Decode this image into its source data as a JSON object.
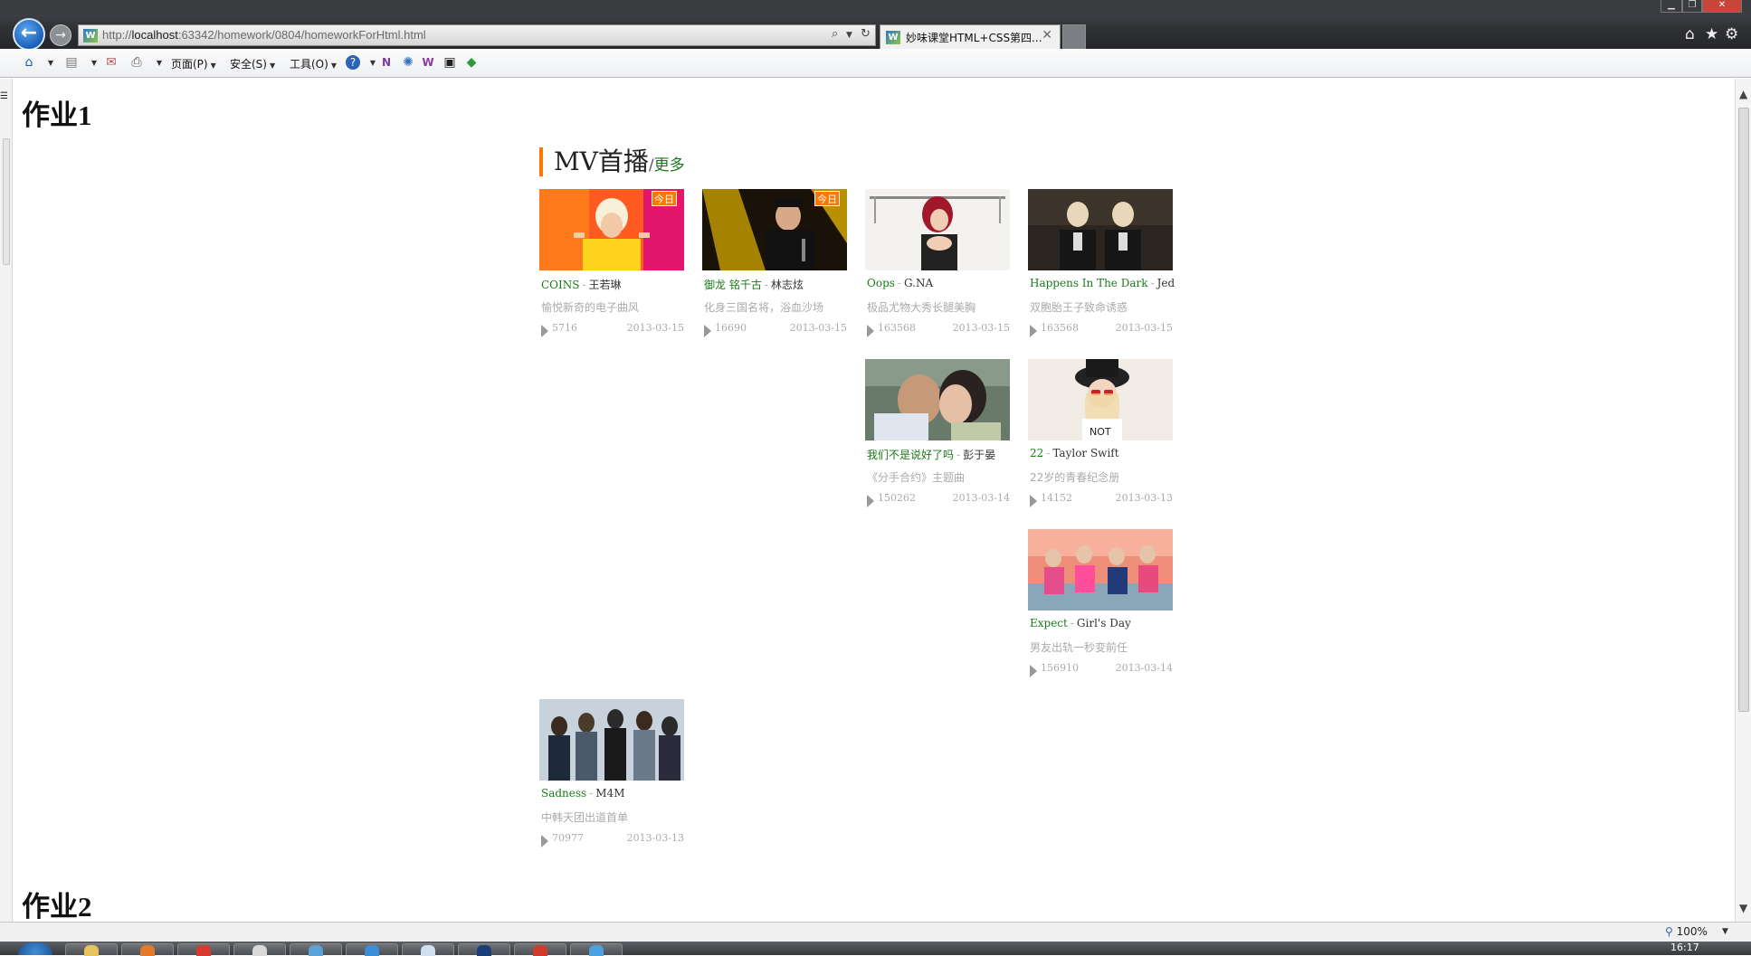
{
  "browser": {
    "url_prefix": "http://",
    "url_host": "localhost",
    "url_rest": ":63342/homework/0804/homeworkForHtml.html",
    "tab_title": "妙味课堂HTML+CSS第四...",
    "tab_close": "✕",
    "menus": {
      "page": "页面(P)",
      "safety": "安全(S)",
      "tools": "工具(O)"
    },
    "zoom": "100%",
    "clock": "16:17"
  },
  "page": {
    "hw1_title": "作业1",
    "hw2_title": "作业2",
    "mv": {
      "title": "MV首播",
      "separator": "/",
      "more": "更多",
      "badge": "今日",
      "items": [
        {
          "song": "COINS",
          "artist": "王若琳",
          "desc": "愉悦新奇的电子曲风",
          "count": "5716",
          "date": "2013-03-15",
          "badge": true,
          "thumb": "pink-yellow"
        },
        {
          "song": "御龙 铭千古",
          "artist": "林志炫",
          "desc": "化身三国名将，浴血沙场",
          "count": "16690",
          "date": "2013-03-15",
          "badge": true,
          "thumb": "stage-yellow"
        },
        {
          "song": "Oops",
          "artist": "G.NA",
          "desc": "极品尤物大秀长腿美胸",
          "count": "163568",
          "date": "2013-03-15",
          "badge": false,
          "thumb": "white-room"
        },
        {
          "song": "Happens In The Dark",
          "artist": "Jed",
          "desc": "双胞胎王子致命诱惑",
          "count": "163568",
          "date": "2013-03-15",
          "badge": false,
          "thumb": "dark-twins"
        },
        {
          "song": "我们不是说好了吗",
          "artist": "彭于晏",
          "desc": "《分手合约》主题曲",
          "count": "150262",
          "date": "2013-03-14",
          "badge": false,
          "thumb": "kiss"
        },
        {
          "song": "22",
          "artist": "Taylor Swift",
          "desc": "22岁的青春纪念册",
          "count": "14152",
          "date": "2013-03-13",
          "badge": false,
          "thumb": "hat-girl"
        },
        {
          "song": "Expect",
          "artist": "Girl's Day",
          "desc": "男友出轨一秒变前任",
          "count": "156910",
          "date": "2013-03-14",
          "badge": false,
          "thumb": "girls-pink"
        },
        {
          "song": "Sadness",
          "artist": "M4M",
          "desc": "中韩天团出道首单",
          "count": "70977",
          "date": "2013-03-13",
          "badge": false,
          "thumb": "band"
        }
      ]
    }
  }
}
